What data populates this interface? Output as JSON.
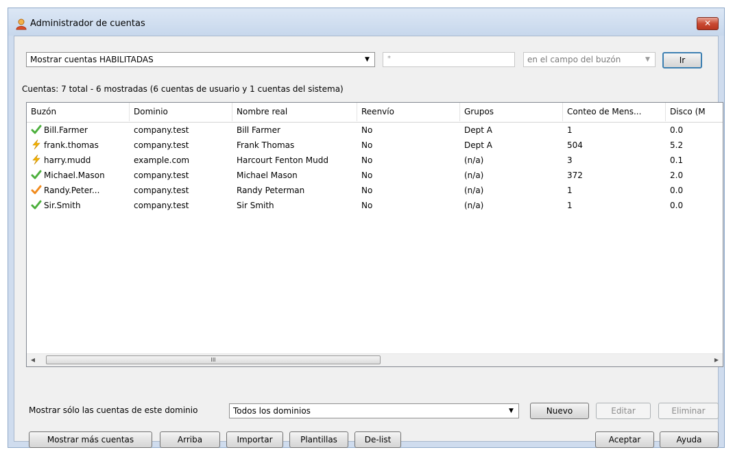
{
  "window": {
    "title": "Administrador de cuentas",
    "close_label": "✕"
  },
  "filter": {
    "show_select": "Mostrar cuentas HABILITADAS",
    "search_value": "*",
    "field_select": "en el campo del buzón",
    "go_label": "Ir"
  },
  "summary": "Cuentas: 7 total - 6 mostradas (6 cuentas de usuario y 1 cuentas del sistema)",
  "table": {
    "columns": [
      "Buzón",
      "Dominio",
      "Nombre real",
      "Reenvío",
      "Grupos",
      "Conteo de Mens...",
      "Disco (M"
    ],
    "rows": [
      {
        "status_icon": "check-icon",
        "mailbox": "Bill.Farmer",
        "domain": "company.test",
        "real_name": "Bill Farmer",
        "forward": "No",
        "groups": "Dept A",
        "msg_count": "1",
        "disk": "0.0"
      },
      {
        "status_icon": "lightning-icon",
        "mailbox": "frank.thomas",
        "domain": "company.test",
        "real_name": "Frank Thomas",
        "forward": "No",
        "groups": "Dept A",
        "msg_count": "504",
        "disk": "5.2"
      },
      {
        "status_icon": "lightning-icon",
        "mailbox": "harry.mudd",
        "domain": "example.com",
        "real_name": "Harcourt Fenton Mudd",
        "forward": "No",
        "groups": "(n/a)",
        "msg_count": "3",
        "disk": "0.1"
      },
      {
        "status_icon": "check-icon",
        "mailbox": "Michael.Mason",
        "domain": "company.test",
        "real_name": "Michael Mason",
        "forward": "No",
        "groups": "(n/a)",
        "msg_count": "372",
        "disk": "2.0"
      },
      {
        "status_icon": "orange-check-icon",
        "mailbox": "Randy.Peter...",
        "domain": "company.test",
        "real_name": "Randy Peterman",
        "forward": "No",
        "groups": "(n/a)",
        "msg_count": "1",
        "disk": "0.0"
      },
      {
        "status_icon": "check-icon",
        "mailbox": "Sir.Smith",
        "domain": "company.test",
        "real_name": "Sir Smith",
        "forward": "No",
        "groups": "(n/a)",
        "msg_count": "1",
        "disk": "0.0"
      }
    ],
    "scroll_thumb_label": "III"
  },
  "domain_filter": {
    "label": "Mostrar sólo las cuentas de este dominio",
    "select": "Todos los dominios"
  },
  "actions": {
    "new": "Nuevo",
    "edit": "Editar",
    "delete": "Eliminar"
  },
  "bottom": {
    "show_more": "Mostrar más cuentas",
    "up": "Arriba",
    "import": "Importar",
    "templates": "Plantillas",
    "delist": "De-list",
    "ok": "Aceptar",
    "help": "Ayuda"
  },
  "colors": {
    "check": "#4caf3c",
    "orange_check": "#f08a1c",
    "lightning": "#f5b400"
  }
}
